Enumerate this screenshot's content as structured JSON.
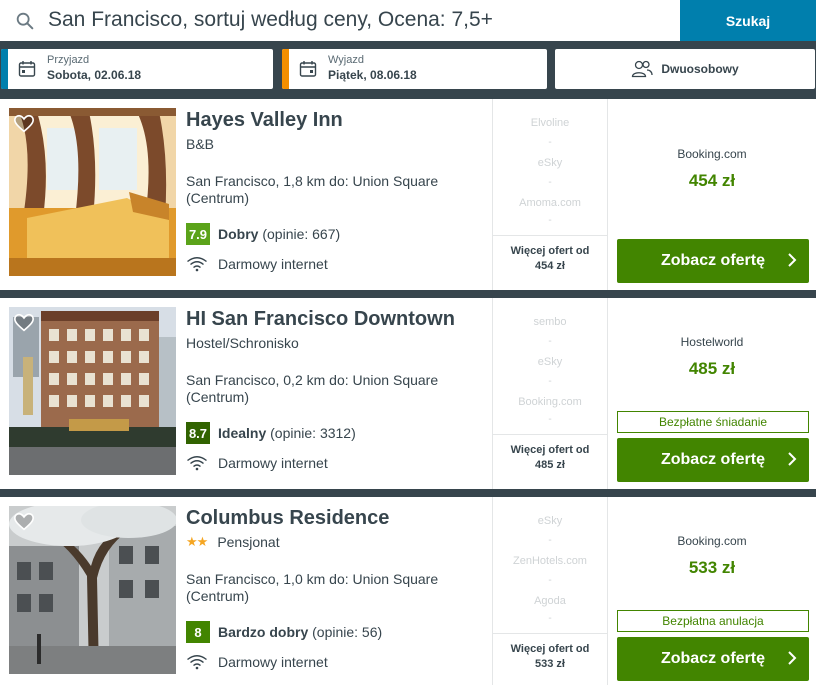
{
  "search": {
    "query": "San Francisco, sortuj według ceny, Ocena: 7,5+",
    "button_label": "Szukaj"
  },
  "checkin": {
    "label": "Przyjazd",
    "value": "Sobota, 02.06.18",
    "color": "#007fad"
  },
  "checkout": {
    "label": "Wyjazd",
    "value": "Piątek, 08.06.18",
    "color": "#f48f00"
  },
  "room": {
    "value": "Dwuosobowy",
    "icon": "two-persons-icon"
  },
  "colors": {
    "rating_dark": "#316300",
    "rating_light": "#5ba31a",
    "deal_green": "#428500",
    "search_blue": "#007fad"
  },
  "hotels": [
    {
      "name": "Hayes Valley Inn",
      "type": "B&B",
      "stars": "",
      "location": "San Francisco, 1,8 km do: Union Square (Centrum)",
      "rating": "7.9",
      "rating_text": "Dobry",
      "reviews": "(opinie: 667)",
      "amenity": "Darmowy internet",
      "partners": [
        "Elvoline",
        "eSky",
        "Amoma.com"
      ],
      "more_offers_line1": "Więcej ofert od",
      "more_offers_line2": "454 zł",
      "best_site": "Booking.com",
      "price": "454 zł",
      "perk": "",
      "deal_label": "Zobacz ofertę"
    },
    {
      "name": "HI San Francisco Downtown",
      "type": "Hostel/Schronisko",
      "stars": "",
      "location": "San Francisco, 0,2 km do: Union Square (Centrum)",
      "rating": "8.7",
      "rating_text": "Idealny",
      "reviews": "(opinie: 3312)",
      "amenity": "Darmowy internet",
      "partners": [
        "sembo",
        "eSky",
        "Booking.com"
      ],
      "more_offers_line1": "Więcej ofert od",
      "more_offers_line2": "485 zł",
      "best_site": "Hostelworld",
      "price": "485 zł",
      "perk": "Bezpłatne śniadanie",
      "deal_label": "Zobacz ofertę"
    },
    {
      "name": "Columbus Residence",
      "type": "Pensjonat",
      "stars": "★★",
      "location": "San Francisco, 1,0 km do: Union Square (Centrum)",
      "rating": "8",
      "rating_text": "Bardzo dobry",
      "reviews": "(opinie: 56)",
      "amenity": "Darmowy internet",
      "partners": [
        "eSky",
        "ZenHotels.com",
        "Agoda"
      ],
      "more_offers_line1": "Więcej ofert od",
      "more_offers_line2": "533 zł",
      "best_site": "Booking.com",
      "price": "533 zł",
      "perk": "Bezpłatna anulacja",
      "deal_label": "Zobacz ofertę"
    }
  ]
}
